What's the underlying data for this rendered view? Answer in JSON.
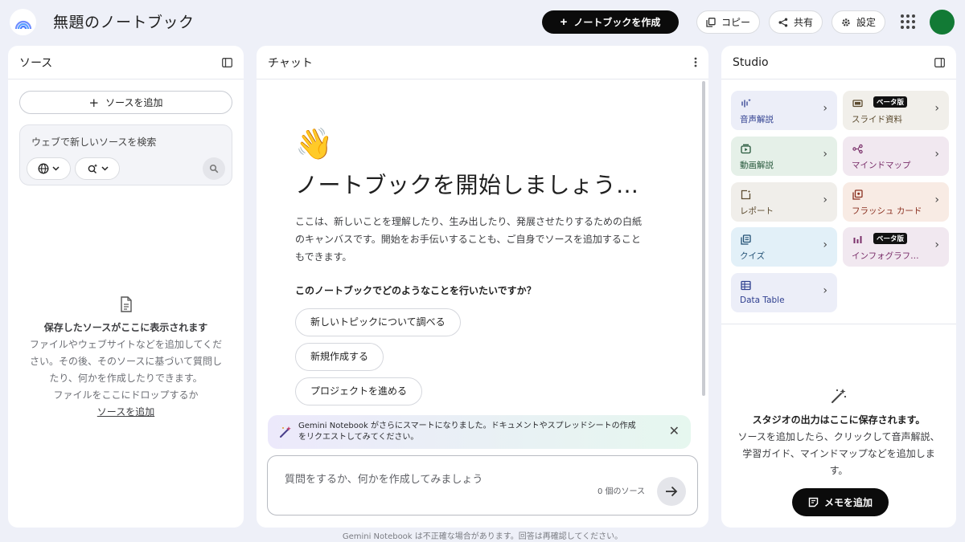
{
  "header": {
    "title": "無題のノートブック",
    "create_label": "ノートブックを作成",
    "copy_label": "コピー",
    "share_label": "共有",
    "settings_label": "設定"
  },
  "sources": {
    "title": "ソース",
    "add_label": "ソースを追加",
    "search_placeholder": "ウェブで新しいソースを検索",
    "empty_title": "保存したソースがここに表示されます",
    "empty_line1": "ファイルやウェブサイトなどを追加してくだ",
    "empty_line2": "さい。その後、そのソースに基づいて質問し",
    "empty_line3": "たり、何かを作成したりできます。",
    "empty_line4": "ファイルをここにドロップするか",
    "empty_link": "ソースを追加"
  },
  "chat": {
    "title": "チャット",
    "wave_emoji": "👋",
    "headline": "ノートブックを開始しましょう…",
    "desc_line1": "ここは、新しいことを理解したり、生み出したり、発展させたりするための白紙",
    "desc_line2": "のキャンバスです。開始をお手伝いすることも、ご自身でソースを追加すること",
    "desc_line3": "もできます。",
    "question": "このノートブックでどのようなことを行いたいですか？",
    "suggestions": [
      "新しいトピックについて調べる",
      "新規作成する",
      "プロジェクトを進める"
    ],
    "banner_line1": "Gemini Notebook がさらにスマートになりました。ドキュメントやスプレッドシートの作成",
    "banner_line2": "をリクエストしてみてください。",
    "input_placeholder": "質問をするか、何かを作成してみましょう",
    "source_count": "0 個のソース"
  },
  "studio": {
    "title": "Studio",
    "tiles": [
      {
        "label": "音声解説",
        "bg": "#eceef8",
        "color": "#2f3f8f"
      },
      {
        "label": "スライド資料",
        "bg": "#f1efea",
        "color": "#5c4b2f",
        "badge": "ベータ版"
      },
      {
        "label": "動画解説",
        "bg": "#e5f0e8",
        "color": "#25573a"
      },
      {
        "label": "マインドマップ",
        "bg": "#f1e8f0",
        "color": "#7a2f6a"
      },
      {
        "label": "レポート",
        "bg": "#f0eeea",
        "color": "#5c4b2f"
      },
      {
        "label": "フラッシュ カード",
        "bg": "#f8ebe4",
        "color": "#8a2f1f"
      },
      {
        "label": "クイズ",
        "bg": "#e2f0f8",
        "color": "#1f4e72"
      },
      {
        "label": "インフォグラフ…",
        "bg": "#f1e8f0",
        "color": "#7a2f6a",
        "badge": "ベータ版"
      },
      {
        "label": "Data Table",
        "bg": "#eceef8",
        "color": "#2f3f8f"
      }
    ],
    "empty_title": "スタジオの出力はここに保存されます。",
    "empty_line1": "ソースを追加したら、クリックして音声解説、",
    "empty_line2": "学習ガイド、マインドマップなどを追加しま",
    "empty_line3": "す。",
    "memo_label": "メモを追加"
  },
  "footer": {
    "disclaimer": "Gemini Notebook は不正確な場合があります。回答は再確認してください。"
  }
}
